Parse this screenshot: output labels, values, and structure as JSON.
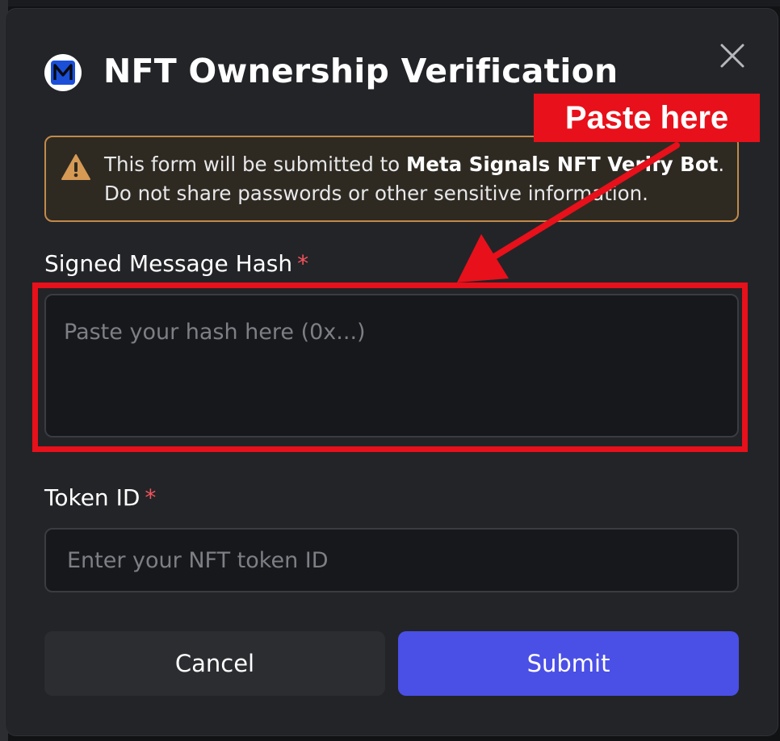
{
  "modal": {
    "title": "NFT Ownership Verification",
    "logo_icon": "bot-logo-icon",
    "close_icon": "close-icon"
  },
  "notice": {
    "icon": "warning-icon",
    "text_before": "This form will be submitted to ",
    "bold": "Meta Signals NFT Verify Bot",
    "text_after": ". Do not share passwords or other sensitive information."
  },
  "fields": {
    "hash": {
      "label": "Signed Message Hash",
      "required_marker": "*",
      "placeholder": "Paste your hash here (0x...)",
      "value": ""
    },
    "token": {
      "label": "Token ID",
      "required_marker": "*",
      "placeholder": "Enter your NFT token ID",
      "value": ""
    }
  },
  "buttons": {
    "cancel": "Cancel",
    "submit": "Submit"
  },
  "annotation": {
    "label": "Paste here",
    "color": "#e8101a"
  },
  "colors": {
    "accent": "#4a4fe6",
    "warning_border": "#c28a4a",
    "required": "#f2545b"
  }
}
